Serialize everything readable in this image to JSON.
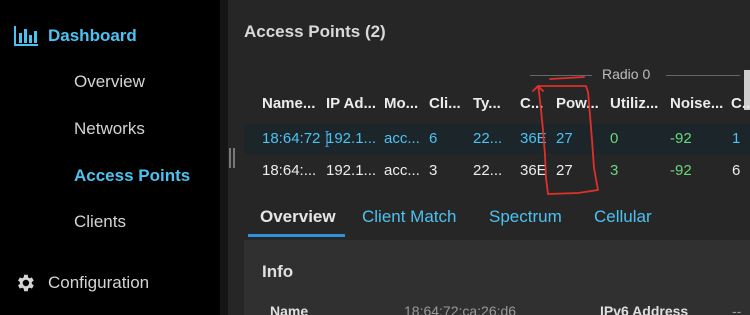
{
  "sidebar": {
    "dashboard_label": "Dashboard",
    "items": [
      {
        "label": "Overview"
      },
      {
        "label": "Networks"
      },
      {
        "label": "Access Points"
      },
      {
        "label": "Clients"
      }
    ],
    "config_label": "Configuration"
  },
  "main": {
    "title": "Access Points (2)",
    "radio_group": "Radio 0",
    "columns": [
      "Name...",
      "IP Ad...",
      "Mo...",
      "Cli...",
      "Ty...",
      "C...",
      "Pow...",
      "Utiliz...",
      "Noise...",
      "C..."
    ],
    "rows": [
      {
        "name": "18:64:72",
        "ip": "192.1...",
        "model": "acc...",
        "clients": "6",
        "type": "22...",
        "channel": "36E",
        "power": "27",
        "util": "0",
        "noise": "-92",
        "c": "1"
      },
      {
        "name": "18:64:...",
        "ip": "192.1...",
        "model": "acc...",
        "clients": "3",
        "type": "22...",
        "channel": "36E",
        "power": "27",
        "util": "3",
        "noise": "-92",
        "c": "6"
      }
    ],
    "tabs": [
      "Overview",
      "Client Match",
      "Spectrum",
      "Cellular"
    ],
    "panel": {
      "title": "Info",
      "name_label": "Name",
      "name_value": "18:64:72:ca:26:d6",
      "ipv6_label": "IPv6 Address",
      "ipv6_value": "--"
    }
  },
  "colors": {
    "accent": "#4cc2f2",
    "sidebar_bg": "#000000",
    "main_bg": "#262626",
    "good": "#6cd77c",
    "annotation": "#e0302a"
  }
}
